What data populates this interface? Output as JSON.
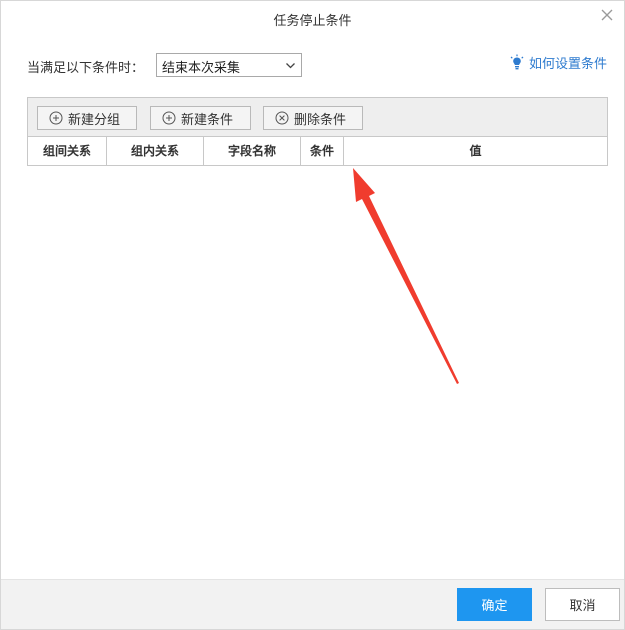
{
  "dialog": {
    "title": "任务停止条件",
    "close_icon": "close-icon"
  },
  "condition": {
    "label": "当满足以下条件时：",
    "select_value": "结束本次采集"
  },
  "help": {
    "icon": "lightbulb-icon",
    "text": "如何设置条件",
    "color": "#2e7bcf"
  },
  "toolbar": {
    "new_group": "新建分组",
    "new_condition": "新建条件",
    "delete_condition": "删除条件"
  },
  "table": {
    "columns": [
      "组间关系",
      "组内关系",
      "字段名称",
      "条件",
      "值"
    ]
  },
  "footer": {
    "ok": "确定",
    "cancel": "取消"
  },
  "colors": {
    "primary": "#1e96f0",
    "annotation": "#f03c2e"
  }
}
